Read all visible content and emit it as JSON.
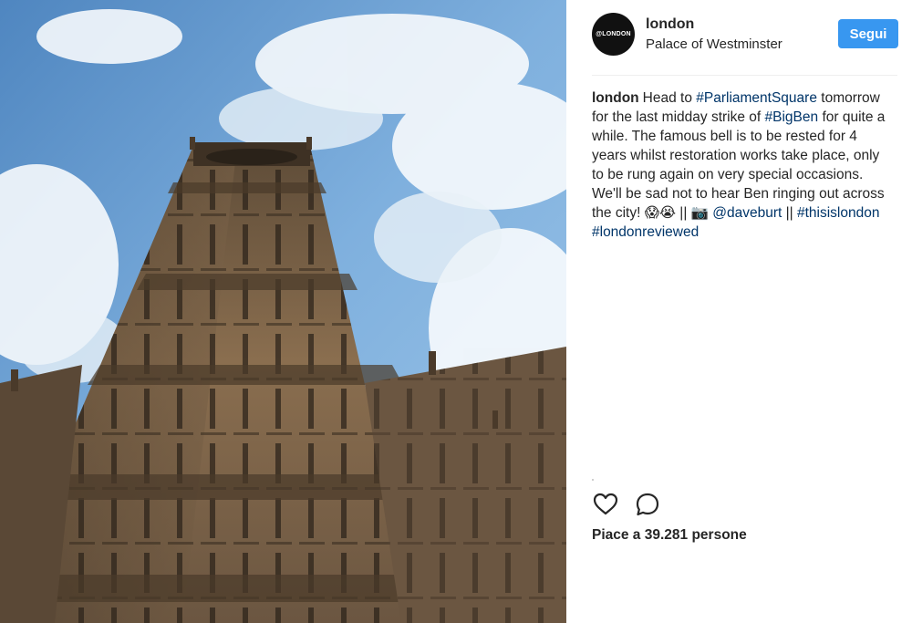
{
  "post": {
    "username": "london",
    "location": "Palace of Westminster",
    "avatar_text": "@LONDON",
    "follow_label": "Segui",
    "caption": {
      "username": "london",
      "segments": [
        {
          "type": "text",
          "text": "Head to "
        },
        {
          "type": "tag",
          "text": "#ParliamentSquare"
        },
        {
          "type": "text",
          "text": " tomorrow for the last midday strike of "
        },
        {
          "type": "tag",
          "text": "#BigBen"
        },
        {
          "type": "text",
          "text": " for quite a while. The famous bell is to be rested for 4 years whilst restoration works take place, only to be rung again on very special occasions. We'll be sad not to hear Ben ringing out across the city! 😱😭 || 📷 "
        },
        {
          "type": "tag",
          "text": "@daveburt"
        },
        {
          "type": "text",
          "text": " || "
        },
        {
          "type": "tag",
          "text": "#thisislondon"
        },
        {
          "type": "text",
          "text": " "
        },
        {
          "type": "tag",
          "text": "#londonreviewed"
        }
      ]
    },
    "likes_text": "Piace a 39.281 persone",
    "icons": {
      "like": "heart-icon",
      "comment": "speech-bubble-icon"
    },
    "colors": {
      "follow_button": "#3897f0",
      "link": "#003569",
      "text": "#262626"
    }
  }
}
